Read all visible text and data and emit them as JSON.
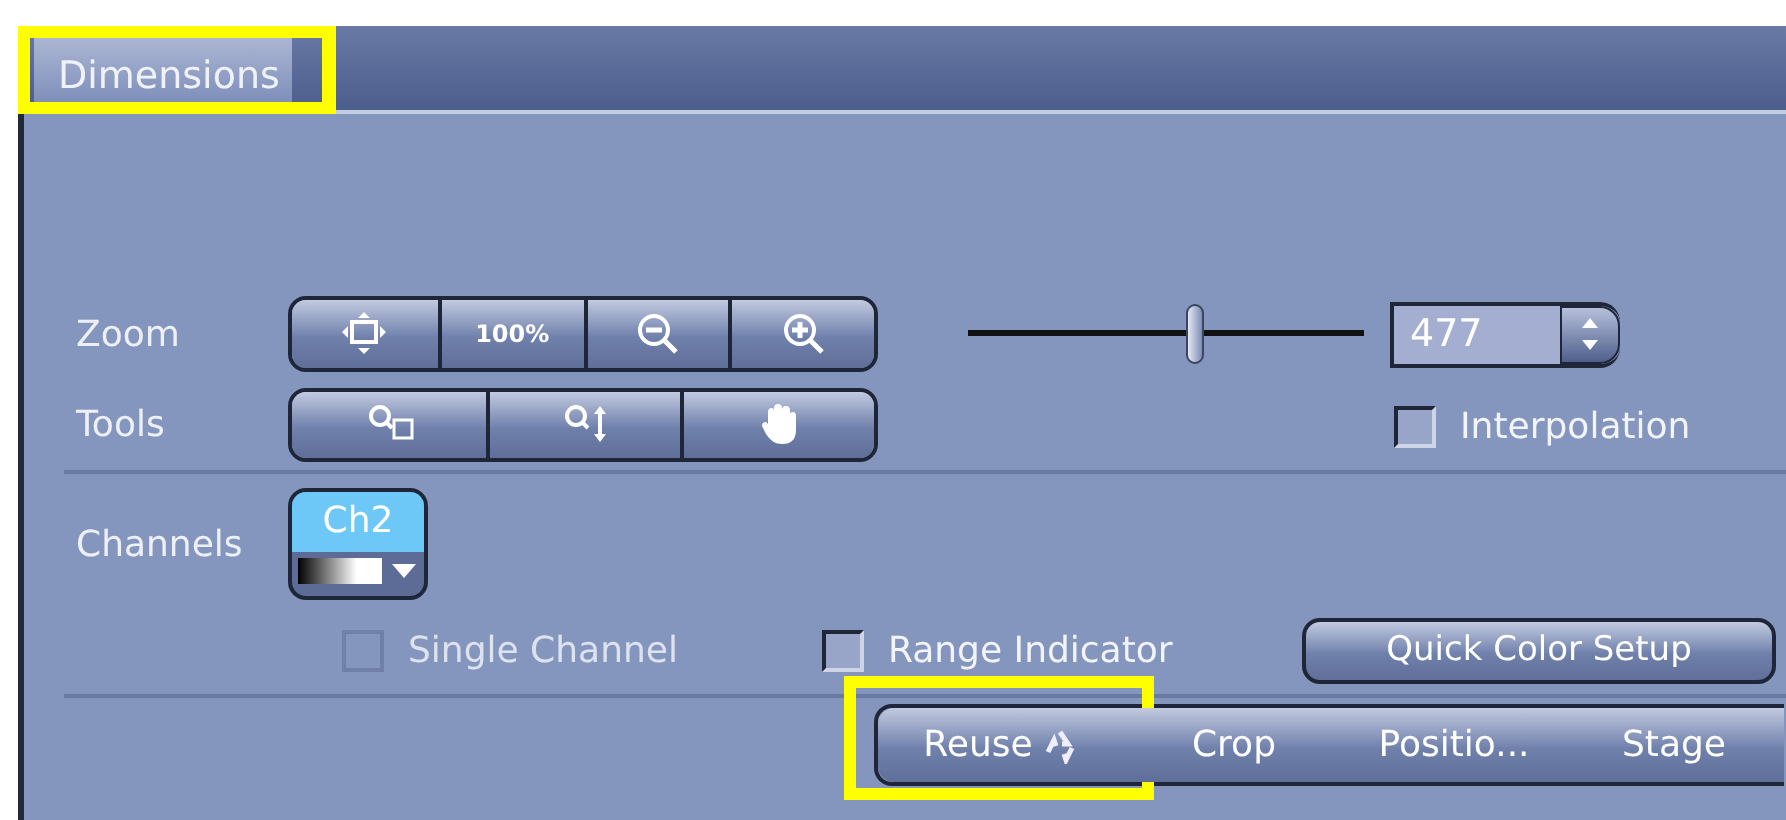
{
  "panel": {
    "tab": {
      "label": "Dimensions",
      "highlighted": true
    }
  },
  "zoom": {
    "label": "Zoom",
    "buttons": [
      {
        "kind": "fit"
      },
      {
        "kind": "text",
        "label": "100%"
      },
      {
        "kind": "zoom-out"
      },
      {
        "kind": "zoom-in"
      }
    ],
    "slider": {
      "level": 0.57
    },
    "value": "477"
  },
  "tools": {
    "label": "Tools",
    "buttons": [
      {
        "kind": "zoom-rect"
      },
      {
        "kind": "zoom-drag"
      },
      {
        "kind": "hand"
      }
    ]
  },
  "interpolation": {
    "label": "Interpolation",
    "checked": false
  },
  "channels": {
    "label": "Channels",
    "items": [
      {
        "label": "Ch2",
        "selected": true
      }
    ]
  },
  "options": [
    {
      "label": "Single Channel",
      "checked": false,
      "disabled": true
    },
    {
      "label": "Range Indicator",
      "checked": false,
      "disabled": false
    }
  ],
  "quick_color": "Quick Color Setup",
  "bottom_buttons": [
    {
      "label": "Reuse",
      "icon": true,
      "highlighted": true
    },
    {
      "label": "Crop",
      "icon": false,
      "highlighted": false
    },
    {
      "label": "Positio...",
      "icon": false,
      "highlighted": false
    },
    {
      "label": "Stage",
      "icon": false,
      "highlighted": false
    }
  ]
}
